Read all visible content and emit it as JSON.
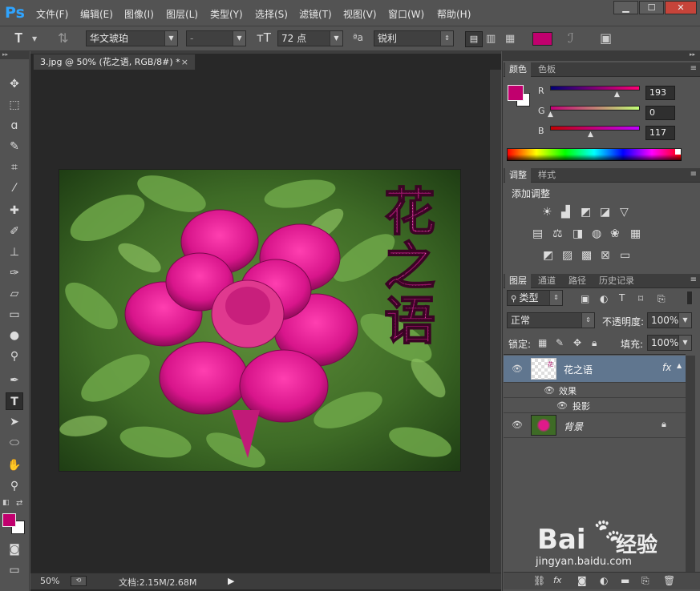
{
  "app": {
    "logo": "Ps"
  },
  "menu": [
    "文件(F)",
    "编辑(E)",
    "图像(I)",
    "图层(L)",
    "类型(Y)",
    "选择(S)",
    "滤镜(T)",
    "视图(V)",
    "窗口(W)",
    "帮助(H)"
  ],
  "window_buttons": [
    "▁",
    "☐",
    "✕"
  ],
  "options": {
    "font_family": "华文琥珀",
    "font_style": "-",
    "font_size": "72 点",
    "aa_label": "ªa",
    "anti_alias": "锐利",
    "text_color": "#c1006e"
  },
  "document": {
    "tab_title": "3.jpg @ 50% (花之语, RGB/8#) *",
    "overlay_text": [
      "花",
      "之",
      "语"
    ],
    "zoom": "50%",
    "doc_info": "文档:2.15M/2.68M"
  },
  "color_panel": {
    "tabs": [
      "颜色",
      "色板"
    ],
    "r_label": "R",
    "g_label": "G",
    "b_label": "B",
    "r": "193",
    "g": "0",
    "b": "117",
    "fg_color": "#c1006e"
  },
  "adjust_panel": {
    "tabs": [
      "调整",
      "样式"
    ],
    "title": "添加调整"
  },
  "layers_panel": {
    "tabs": [
      "图层",
      "通道",
      "路径",
      "历史记录"
    ],
    "filter_kind": "类型",
    "blend_mode": "正常",
    "opacity_label": "不透明度:",
    "opacity": "100%",
    "lock_label": "锁定:",
    "fill_label": "填充:",
    "fill": "100%",
    "layers": [
      {
        "name": "花之语",
        "fx": "fx",
        "effects_label": "效果",
        "effect": "投影"
      },
      {
        "name": "背景"
      }
    ]
  },
  "watermark": {
    "brand": "Bai",
    "brand2": "经验",
    "url": "jingyan.baidu.com"
  }
}
